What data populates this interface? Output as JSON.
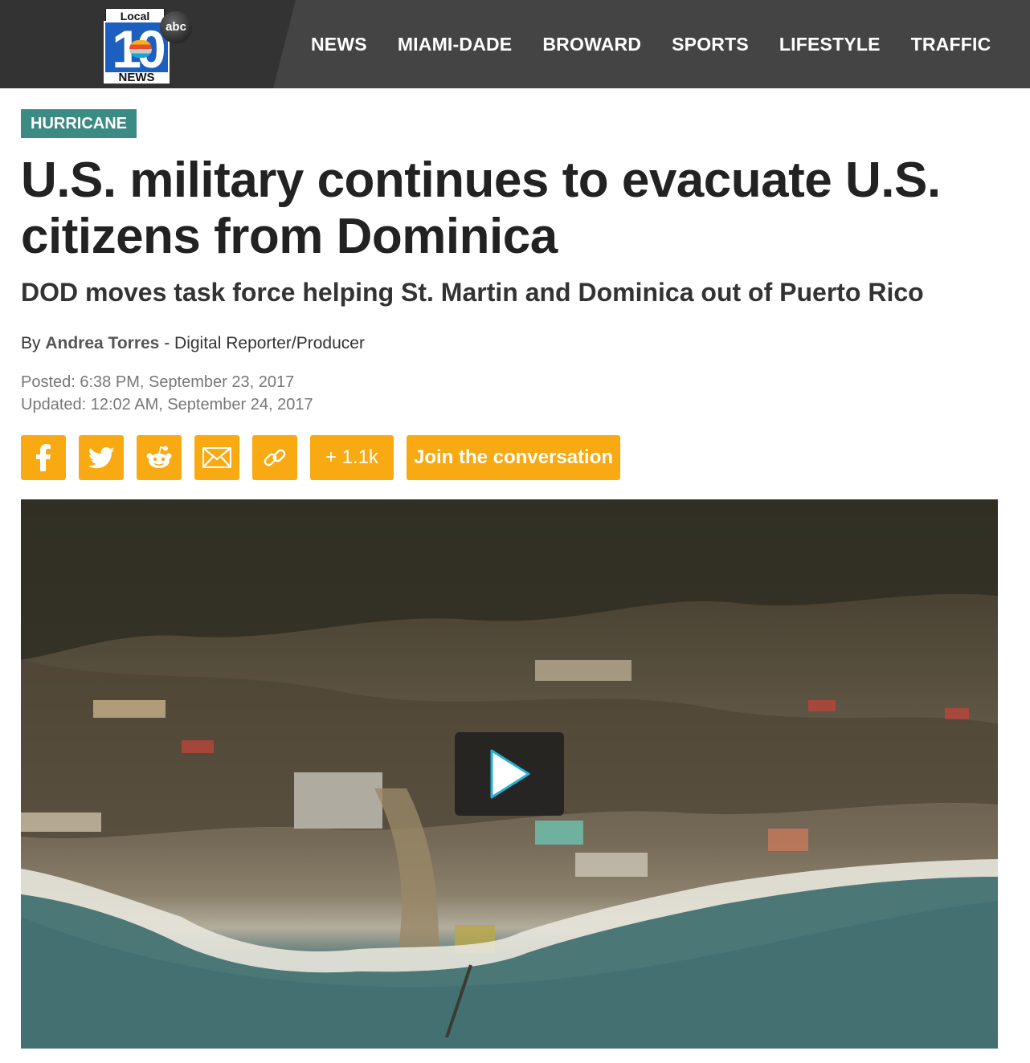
{
  "header": {
    "logo": {
      "top_text": "Local",
      "number": "10",
      "bottom_text": "NEWS",
      "network": "abc"
    },
    "nav": [
      "NEWS",
      "MIAMI-DADE",
      "BROWARD",
      "SPORTS",
      "LIFESTYLE",
      "TRAFFIC"
    ]
  },
  "article": {
    "category": "HURRICANE",
    "headline": "U.S. military continues to evacuate U.S. citizens from Dominica",
    "subheadline": "DOD moves task force helping St. Martin and Dominica out of Puerto Rico",
    "byline": {
      "prefix": "By",
      "author": "Andrea Torres",
      "role": "- Digital Reporter/Producer"
    },
    "posted": "Posted: 6:38 PM, September 23, 2017",
    "updated": "Updated: 12:02 AM, September 24, 2017"
  },
  "share": {
    "icons": [
      "facebook-icon",
      "twitter-icon",
      "reddit-icon",
      "email-icon",
      "link-icon"
    ],
    "count_label": "+ 1.1k",
    "join_label": "Join the conversation"
  },
  "video": {
    "play_icon": "play-icon"
  },
  "colors": {
    "header_bg": "#444444",
    "category_bg": "#3b8a84",
    "share_button": "#f9a911"
  }
}
